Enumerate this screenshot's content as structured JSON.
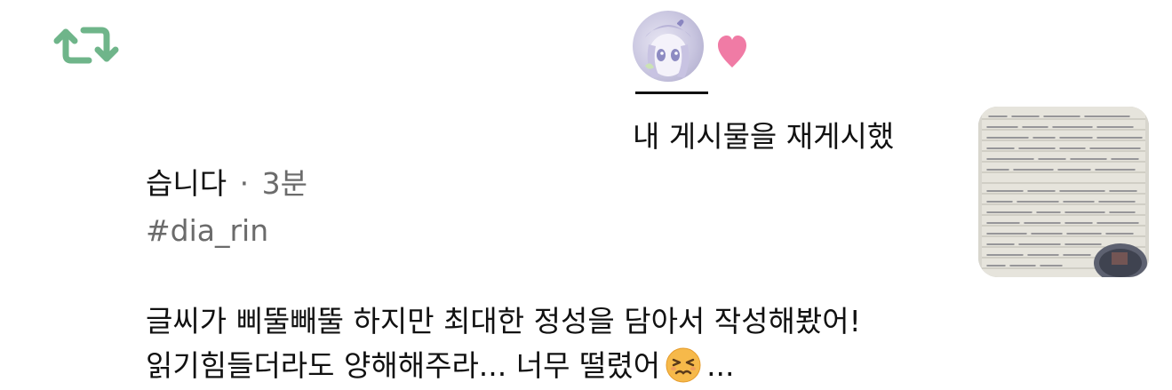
{
  "icons": {
    "repost": "repost-icon",
    "heart": "heart-icon",
    "emoji": "tired-face-emoji"
  },
  "colors": {
    "repost_green": "#6fb58a",
    "heart_pink": "#f07ba5",
    "muted_text": "#6b6b6b"
  },
  "post": {
    "reposted_text_part1": "내 게시물을 재게시했",
    "reposted_text_part2": "습니다",
    "separator": "·",
    "time_ago": "3분",
    "hashtag": "#dia_rin",
    "body_line1": "글씨가 삐뚤빼뚤 하지만 최대한 정성을 담아서 작성해봤어!",
    "body_line2_before_emoji": "읽기힘들더라도 양해해주라... 너무 떨렸어",
    "body_line2_after_emoji": "..."
  }
}
